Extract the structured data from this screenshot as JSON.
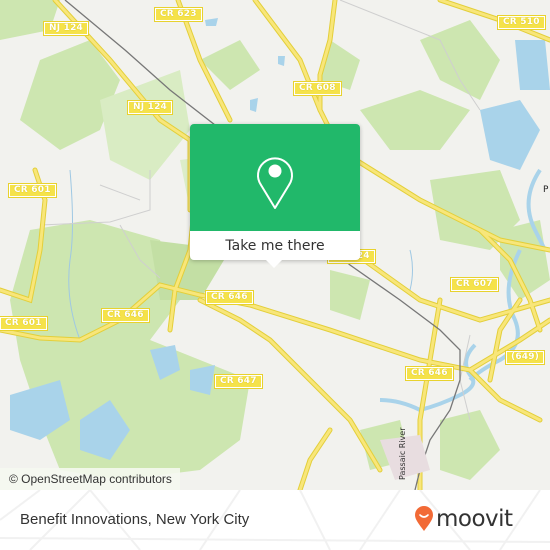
{
  "map": {
    "road_labels": [
      {
        "id": "nj124-top",
        "text": "NJ 124"
      },
      {
        "id": "cr623",
        "text": "CR 623"
      },
      {
        "id": "cr510",
        "text": "CR 510"
      },
      {
        "id": "cr608",
        "text": "CR 608"
      },
      {
        "id": "nj124-mid",
        "text": "NJ 124"
      },
      {
        "id": "cr601-top",
        "text": "CR 601"
      },
      {
        "id": "cr601-bottom",
        "text": "CR 601"
      },
      {
        "id": "cr646-left",
        "text": "CR 646"
      },
      {
        "id": "cr646-mid",
        "text": "CR 646"
      },
      {
        "id": "cr646-right",
        "text": "CR 646"
      },
      {
        "id": "cr607",
        "text": "CR 607"
      },
      {
        "id": "r649",
        "text": "(649)"
      },
      {
        "id": "cr647",
        "text": "CR 647"
      },
      {
        "id": "cr124-hidden",
        "text": "CR 124"
      }
    ],
    "river_label": "Passaic River",
    "place_fragment": "P",
    "colors": {
      "background": "#f2f2ee",
      "park": "#cde6b0",
      "water": "#a9d3ea",
      "road": "#f6e35c",
      "rail": "#777777"
    }
  },
  "popup": {
    "icon": "map-pin-icon",
    "action_label": "Take me there",
    "accent_color": "#21b86a"
  },
  "attribution": "© OpenStreetMap contributors",
  "footer": {
    "place_title": "Benefit Innovations, New York City",
    "brand": {
      "name": "moovit",
      "icon": "moovit-smile-pin-icon",
      "color": "#f26a36"
    }
  }
}
